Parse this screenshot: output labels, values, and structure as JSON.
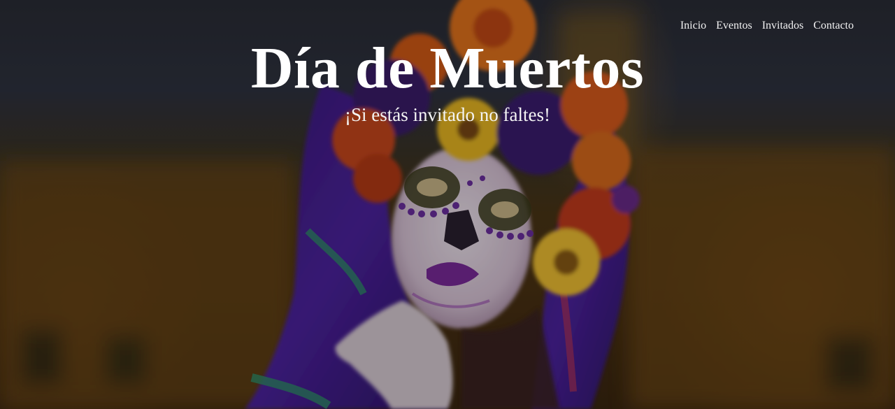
{
  "nav": {
    "items": [
      {
        "label": "Inicio"
      },
      {
        "label": "Eventos"
      },
      {
        "label": "Invitados"
      },
      {
        "label": "Contacto"
      }
    ]
  },
  "hero": {
    "title": "Día de Muertos",
    "subtitle": "¡Si estás invitado no faltes!",
    "overlay_color": "#000000",
    "image": "catrina-portrait"
  }
}
